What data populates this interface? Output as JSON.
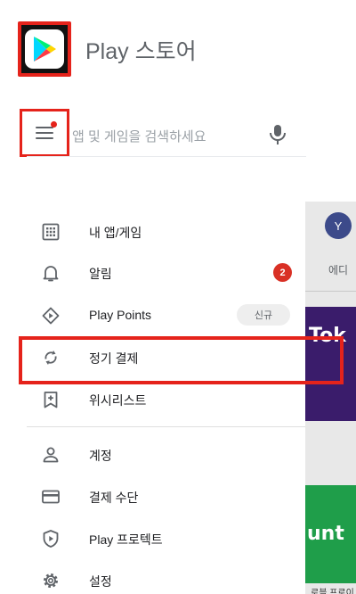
{
  "header": {
    "app_title": "Play 스토어",
    "logo_icon": "google-play-logo"
  },
  "search": {
    "placeholder": "앱 및 게임을 검색하세요",
    "menu_icon": "menu-icon",
    "mic_icon": "microphone-icon"
  },
  "drawer": {
    "items": [
      {
        "label": "내 앱/게임",
        "icon": "apps-grid-icon"
      },
      {
        "label": "알림",
        "icon": "bell-icon",
        "badge": "2"
      },
      {
        "label": "Play Points",
        "icon": "play-points-icon",
        "badge": "신규"
      },
      {
        "label": "정기 결제",
        "icon": "refresh-icon"
      },
      {
        "label": "위시리스트",
        "icon": "bookmark-add-icon"
      },
      {
        "label": "계정",
        "icon": "person-icon"
      },
      {
        "label": "결제 수단",
        "icon": "credit-card-icon"
      },
      {
        "label": "Play 프로텍트",
        "icon": "shield-play-icon"
      },
      {
        "label": "설정",
        "icon": "gear-icon"
      }
    ]
  },
  "background": {
    "avatar_letter": "Y",
    "tab_label": "에디",
    "game_text": "Tok",
    "green_text": "unt",
    "bottom_text": "로블 프로이"
  },
  "colors": {
    "highlight": "#e5231b",
    "badge_red": "#d93025",
    "icon_grey": "#5f6368"
  }
}
